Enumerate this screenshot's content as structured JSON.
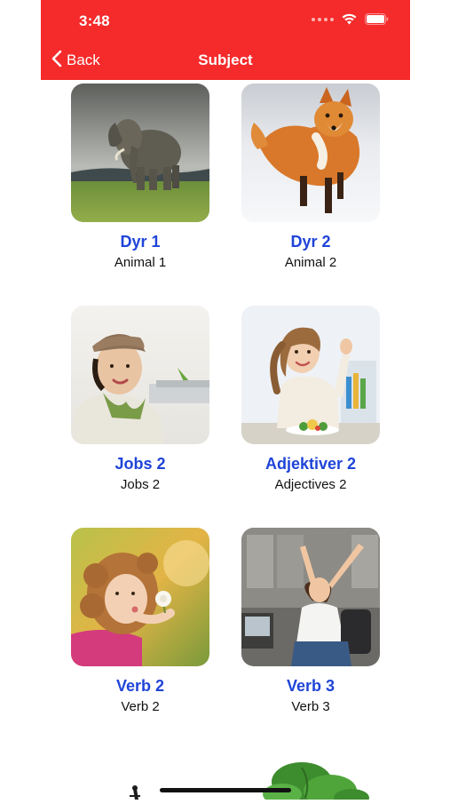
{
  "status_bar": {
    "time": "3:48"
  },
  "nav": {
    "back_label": "Back",
    "title": "Subject",
    "accent_color": "#f52a2a"
  },
  "subjects": [
    {
      "title": "Dyr 1",
      "subtitle": "Animal 1",
      "image": "elephant-photo"
    },
    {
      "title": "Dyr 2",
      "subtitle": "Animal 2",
      "image": "fox-photo"
    },
    {
      "title": "Jobs 2",
      "subtitle": "Jobs 2",
      "image": "flight-attendant-photo"
    },
    {
      "title": "Adjektiver 2",
      "subtitle": "Adjectives 2",
      "image": "girl-thumbs-up-photo"
    },
    {
      "title": "Verb 2",
      "subtitle": "Verb 2",
      "image": "girl-blowing-dandelion-photo"
    },
    {
      "title": "Verb 3",
      "subtitle": "Verb 3",
      "image": "woman-stretching-photo"
    }
  ],
  "colors": {
    "title_blue": "#1f44d8"
  }
}
